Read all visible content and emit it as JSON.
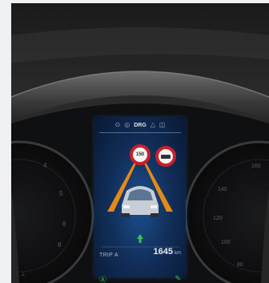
{
  "display": {
    "status": {
      "camera_icon": "camera-icon",
      "steering_icon": "steering-wheel-icon",
      "mode": "DRG",
      "warning_icon": "warning-triangle-icon",
      "door_icon": "door-icon"
    },
    "signs": {
      "left_text": "150",
      "left_icon": "speed-limit-sign-icon",
      "right_icon": "no-entry-sign-icon"
    },
    "lane_color": "#e58a16",
    "trip": {
      "label": "TRIP A",
      "value": "1645",
      "unit": "km"
    }
  },
  "indicators": {
    "left": "auto-hold-icon",
    "right": "eco-icon",
    "color": "#37c25a"
  }
}
